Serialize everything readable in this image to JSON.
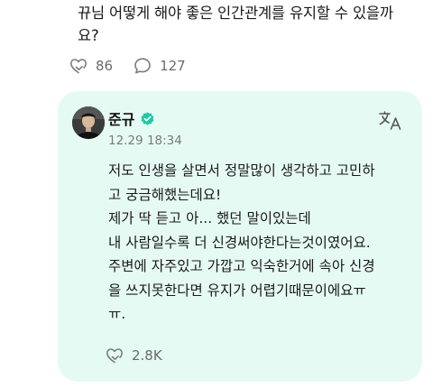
{
  "question": {
    "lines": [
      "뀨님 어떻게 해야 좋은 인간관계를 유지할 수 있을까",
      "요?"
    ],
    "like_count": "86",
    "comment_count": "127"
  },
  "reply": {
    "author": "준규",
    "timestamp": "12.29 18:34",
    "lines": [
      "저도 인생을 살면서 정말많이 생각하고 고민하",
      "고 궁금해했는데요!",
      "제가 딱 듣고 아... 했던 말이있는데",
      "내 사람일수록 더 신경써야한다는것이였어요.",
      "주변에 자주있고 가깝고 익숙한거에 속아 신경",
      "을 쓰지못한다면 유지가 어렵기때문이에요ㅠ",
      "ㅠ."
    ],
    "like_count": "2.8K"
  },
  "icons": {
    "like": "heart-hand-icon",
    "comment": "speech-bubble-icon",
    "translate": "translate-icon",
    "verified": "verified-badge-icon"
  },
  "colors": {
    "card_background": "#e6faf4",
    "verified_badge": "#1fc9a8",
    "muted_text": "#6b6b6b"
  }
}
